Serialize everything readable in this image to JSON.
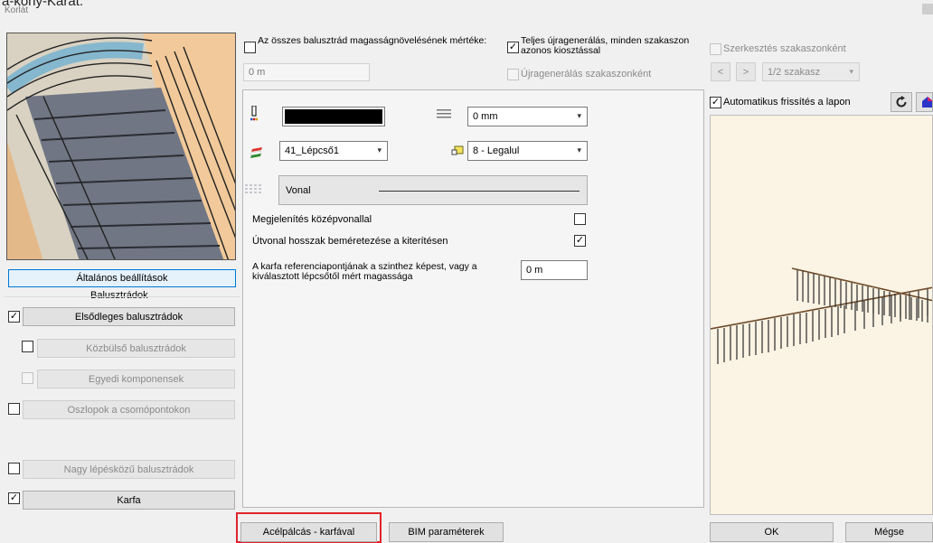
{
  "partial_title": "a-kony-Karat.",
  "window_title": "Korlát",
  "left": {
    "general_settings": "Általános beállítások",
    "balusters_heading": "Balusztrádok",
    "primary": "Elsődleges balusztrádok",
    "intermediate": "Közbülső balusztrádok",
    "unique": "Egyedi komponensek",
    "posts": "Oszlopok a csomópontokon",
    "large_step": "Nagy lépésközű balusztrádok",
    "handrail": "Karfa"
  },
  "top": {
    "height_increase_label": "Az összes balusztrád magasságnövelésének mértéke:",
    "height_increase_value": "0 m",
    "full_regen_label": "Teljes újragenerálás, minden szakaszon azonos kiosztással",
    "regen_per_section": "Újragenerálás szakaszonként"
  },
  "props": {
    "line_offset_value": "0 mm",
    "layer_value": "41_Lépcső1",
    "level_value": "8 - Legalul",
    "line_type_label": "Vonal",
    "show_centerline": "Megjelenítés középvonallal",
    "dimension_length": "Útvonal hosszak beméretezése a kiterítésen",
    "ref_height_label": "A karfa referenciapontjának a szinthez képest, vagy a kiválasztott lépcsőtől mért magassága",
    "ref_height_value": "0 m"
  },
  "right": {
    "edit_per_section": "Szerkesztés szakaszonként",
    "prev": "<",
    "next": ">",
    "section_value": "1/2 szakasz",
    "auto_refresh": "Automatikus frissítés a lapon"
  },
  "bottom": {
    "preset": "Acélpálcás - karfával",
    "bim": "BIM paraméterek",
    "ok": "OK",
    "cancel": "Mégse"
  },
  "colors": {
    "color_swatch": "#000000",
    "selection_accent": "#0078d7",
    "highlight_red": "#e0242b",
    "preview_bg": "#fbf3e3"
  }
}
